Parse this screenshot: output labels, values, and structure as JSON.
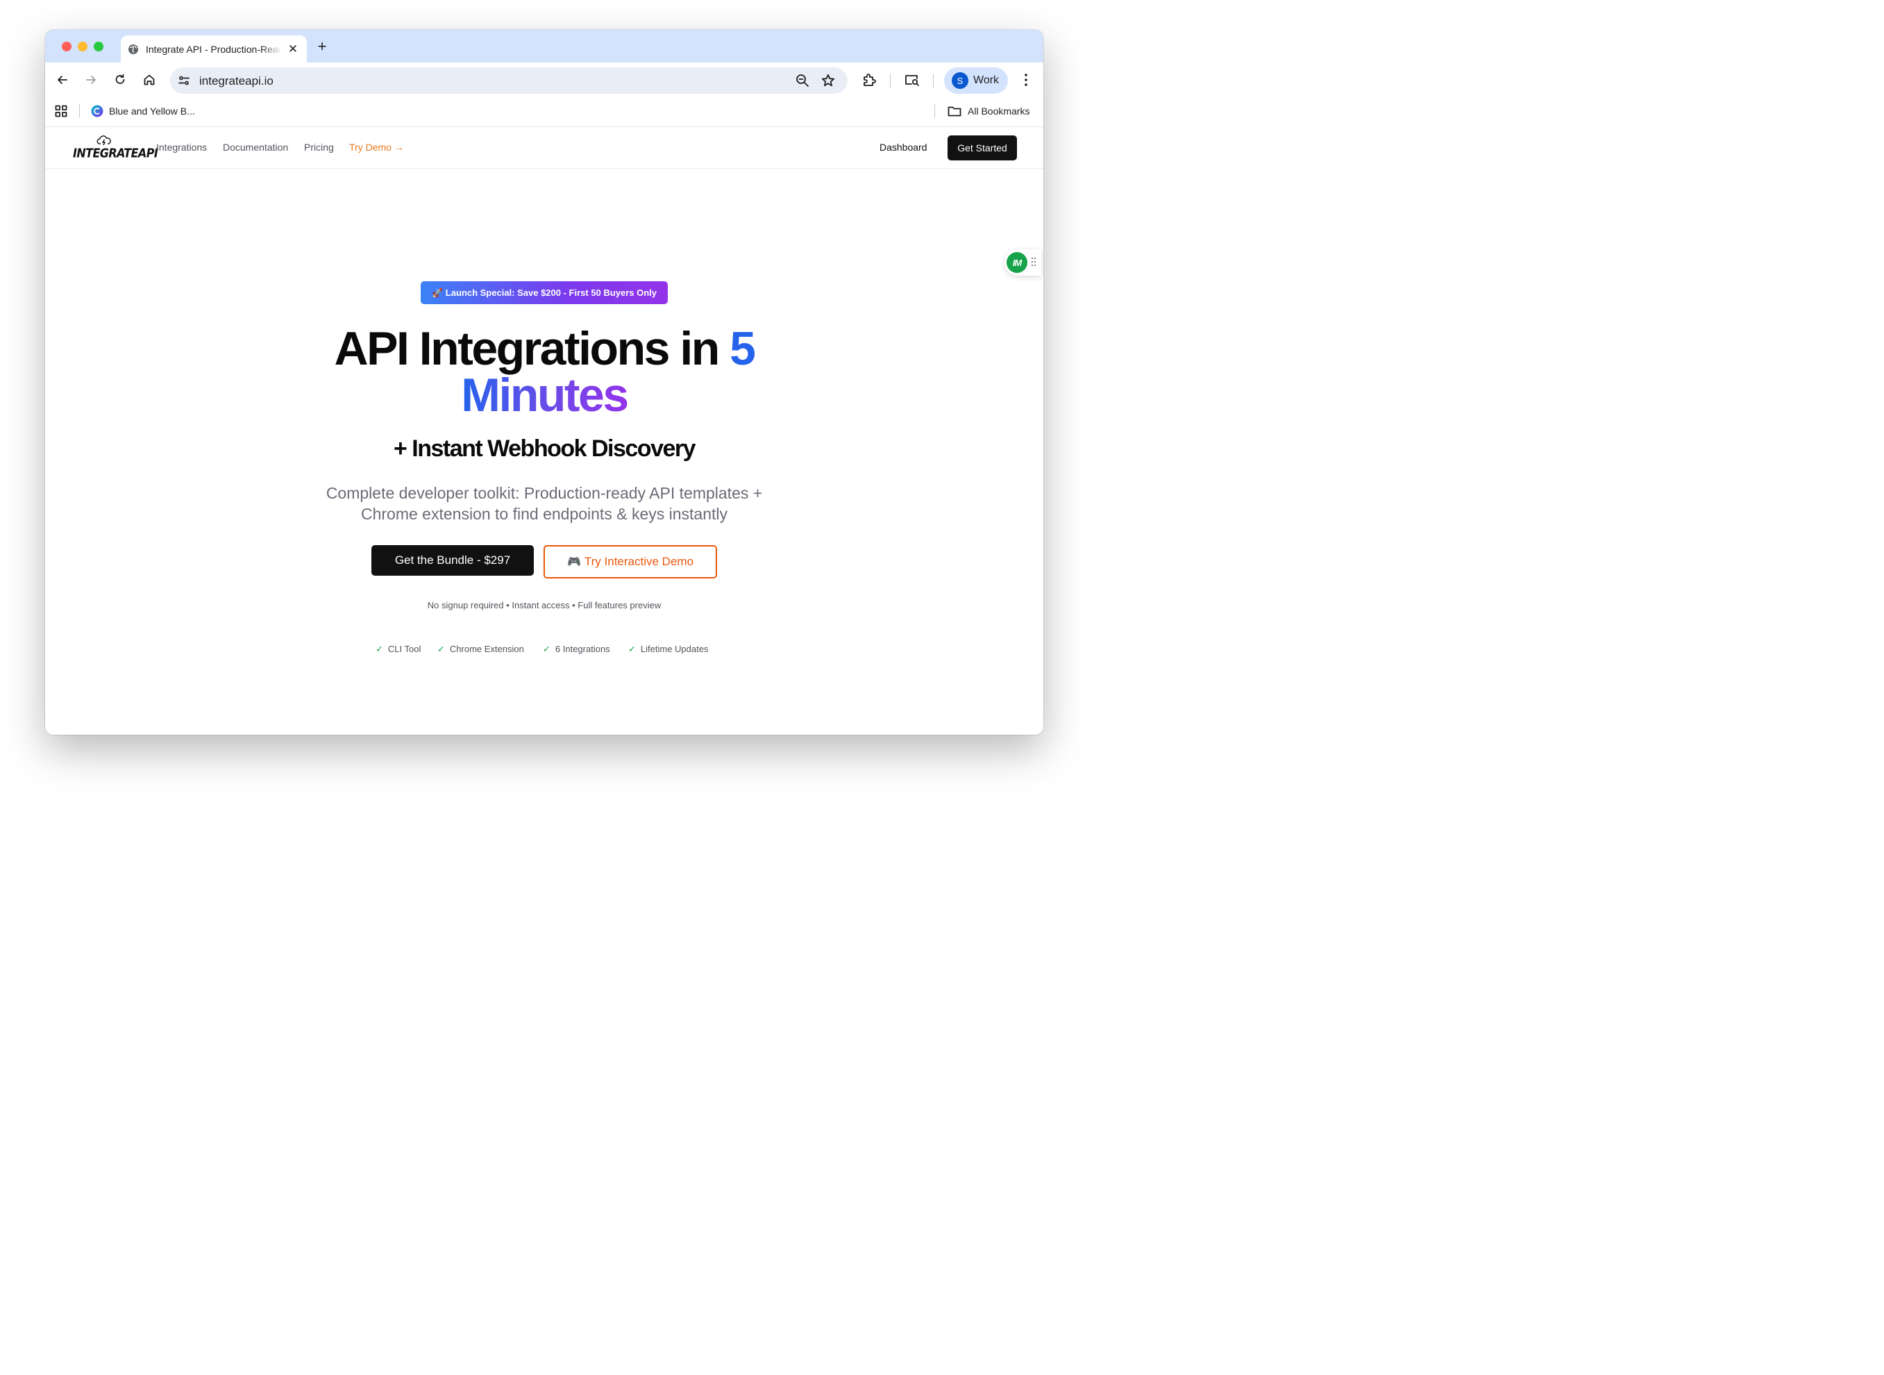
{
  "browser": {
    "tab": {
      "title": "Integrate API - Production-Ready API Integrations"
    },
    "address": {
      "url": "integrateapi.io"
    },
    "profile": {
      "initial": "S",
      "label": "Work"
    },
    "bookmarks": {
      "item": "Blue and Yellow B...",
      "all": "All Bookmarks"
    }
  },
  "site": {
    "logo_text": "INTEGRATEAPI",
    "nav": {
      "integrations": "Integrations",
      "documentation": "Documentation",
      "pricing": "Pricing",
      "try_demo": "Try Demo →",
      "dashboard": "Dashboard",
      "get_started": "Get Started"
    },
    "widget_label": "IM"
  },
  "hero": {
    "badge": "🚀 Launch Special: Save $200 - First 50 Buyers Only",
    "title_part1": "API Integrations in ",
    "title_number": "5",
    "title_line2": "Minutes",
    "subtitle": "+ Instant Webhook Discovery",
    "description": "Complete developer toolkit: Production-ready API templates + Chrome extension to find endpoints & keys instantly",
    "cta_primary": "Get the Bundle - $297",
    "cta_secondary": "Try Interactive Demo",
    "cta_secondary_icon": "🎮",
    "note": "No signup required • Instant access • Full features preview",
    "features": [
      "CLI Tool",
      "Chrome Extension",
      "6 Integrations",
      "Lifetime Updates"
    ],
    "check": "✓"
  },
  "colors": {
    "accent_blue": "#2563eb",
    "accent_purple": "#9333ea",
    "accent_orange": "#ea580c",
    "check_green": "#16a34a"
  }
}
